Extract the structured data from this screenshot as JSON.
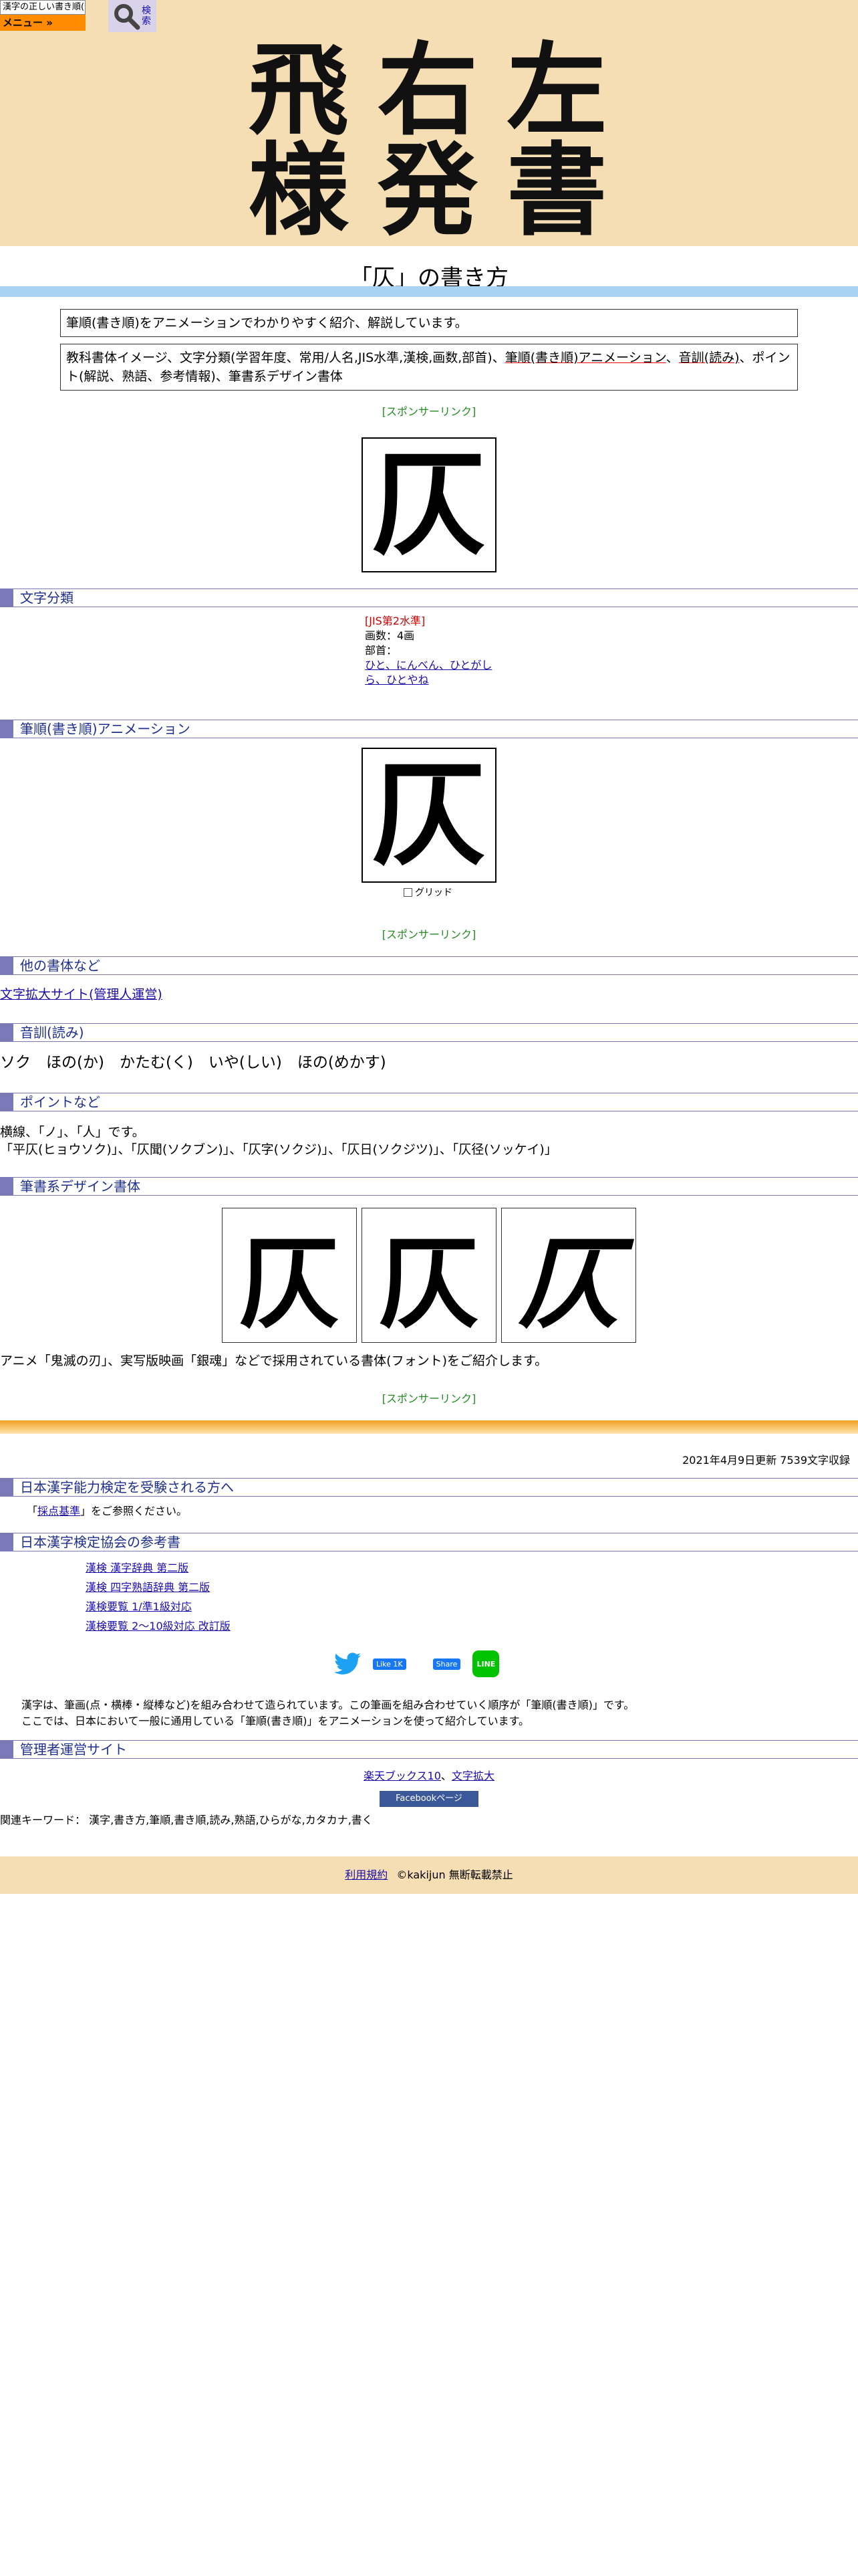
{
  "topbar": {
    "logo_title": "漢字の正しい書き順(筆順)",
    "menu_label": "メニュー »",
    "search_label": "検索"
  },
  "hero": {
    "characters": [
      "飛",
      "右",
      "左",
      "様",
      "発",
      "書"
    ]
  },
  "page_title": "「仄」の書き方",
  "description": {
    "line1": "筆順(書き順)をアニメーションでわかりやすく紹介、解説しています。",
    "line2_plain": "教科書体イメージ、文字分類(学習年度、常用/人名,JIS水準,漢検,画数,部首)、",
    "line2_link1": "筆順(書き順)アニメーション",
    "line2_sep": "、",
    "line2_link2": "音訓(読み)",
    "line2_rest": "、ポイント(解説、熟語、参考情報)、筆書系デザイン書体"
  },
  "sponsor_label": "[スポンサーリンク]",
  "kanji": "仄",
  "sections": {
    "classification": "文字分類",
    "animation": "筆順(書き順)アニメーション",
    "other_styles": "他の書体など",
    "readings": "音訓(読み)",
    "points": "ポイントなど",
    "design_fonts": "筆書系デザイン書体",
    "kanken": "日本漢字能力検定を受験される方へ",
    "references": "日本漢字検定協会の参考書",
    "admin_sites": "管理者運営サイト"
  },
  "classification": {
    "jis_level": "[JIS第2水準]",
    "stroke_count": "画数：4画",
    "radical_label": "部首：",
    "radical_line1": "ひと、にんべん、ひとがし",
    "radical_line2": "ら、ひとやね"
  },
  "grid_label": "グリッド",
  "other_styles_link": "文字拡大サイト(管理人運営)",
  "readings_text": "ソク　ほの(か)　かたむ(く)　いや(しい)　ほの(めかす)",
  "points": {
    "line1": "横線、「ノ」、「人」です。",
    "line2": "「平仄(ヒョウソク)」、「仄聞(ソクブン)」、「仄字(ソクジ)」、「仄日(ソクジツ)」、「仄径(ソッケイ)」"
  },
  "design_note": "アニメ「鬼滅の刃」、実写版映画「銀魂」などで採用されている書体(フォント)をご紹介します。",
  "updated": "2021年4月9日更新 7539文字収録",
  "kanken": {
    "prefix": "「",
    "link": "採点基準",
    "suffix": "」をご参照ください。"
  },
  "references": [
    "漢検 漢字辞典 第二版",
    "漢検 四字熟語辞典 第二版",
    "漢検要覧 1/準1級対応",
    "漢検要覧 2～10級対応 改訂版"
  ],
  "social": {
    "like": "Like 1K",
    "share": "Share",
    "line": "LINE"
  },
  "explanation": {
    "line1": "漢字は、筆画(点・横棒・縦棒など)を組み合わせて造られています。この筆画を組み合わせていく順序が「筆順(書き順)」です。",
    "line2": "ここでは、日本において一般に通用している「筆順(書き順)」をアニメーションを使って紹介しています。"
  },
  "admin_links": {
    "link1": "楽天ブックス10",
    "sep": "、",
    "link2": "文字拡大"
  },
  "fb_page": "Facebookページ",
  "keywords": "関連キーワード：  漢字,書き方,筆順,書き順,読み,熟語,ひらがな,カタカナ,書く",
  "footer": {
    "terms": "利用規約",
    "copyright": "©kakijun 無断転載禁止"
  }
}
